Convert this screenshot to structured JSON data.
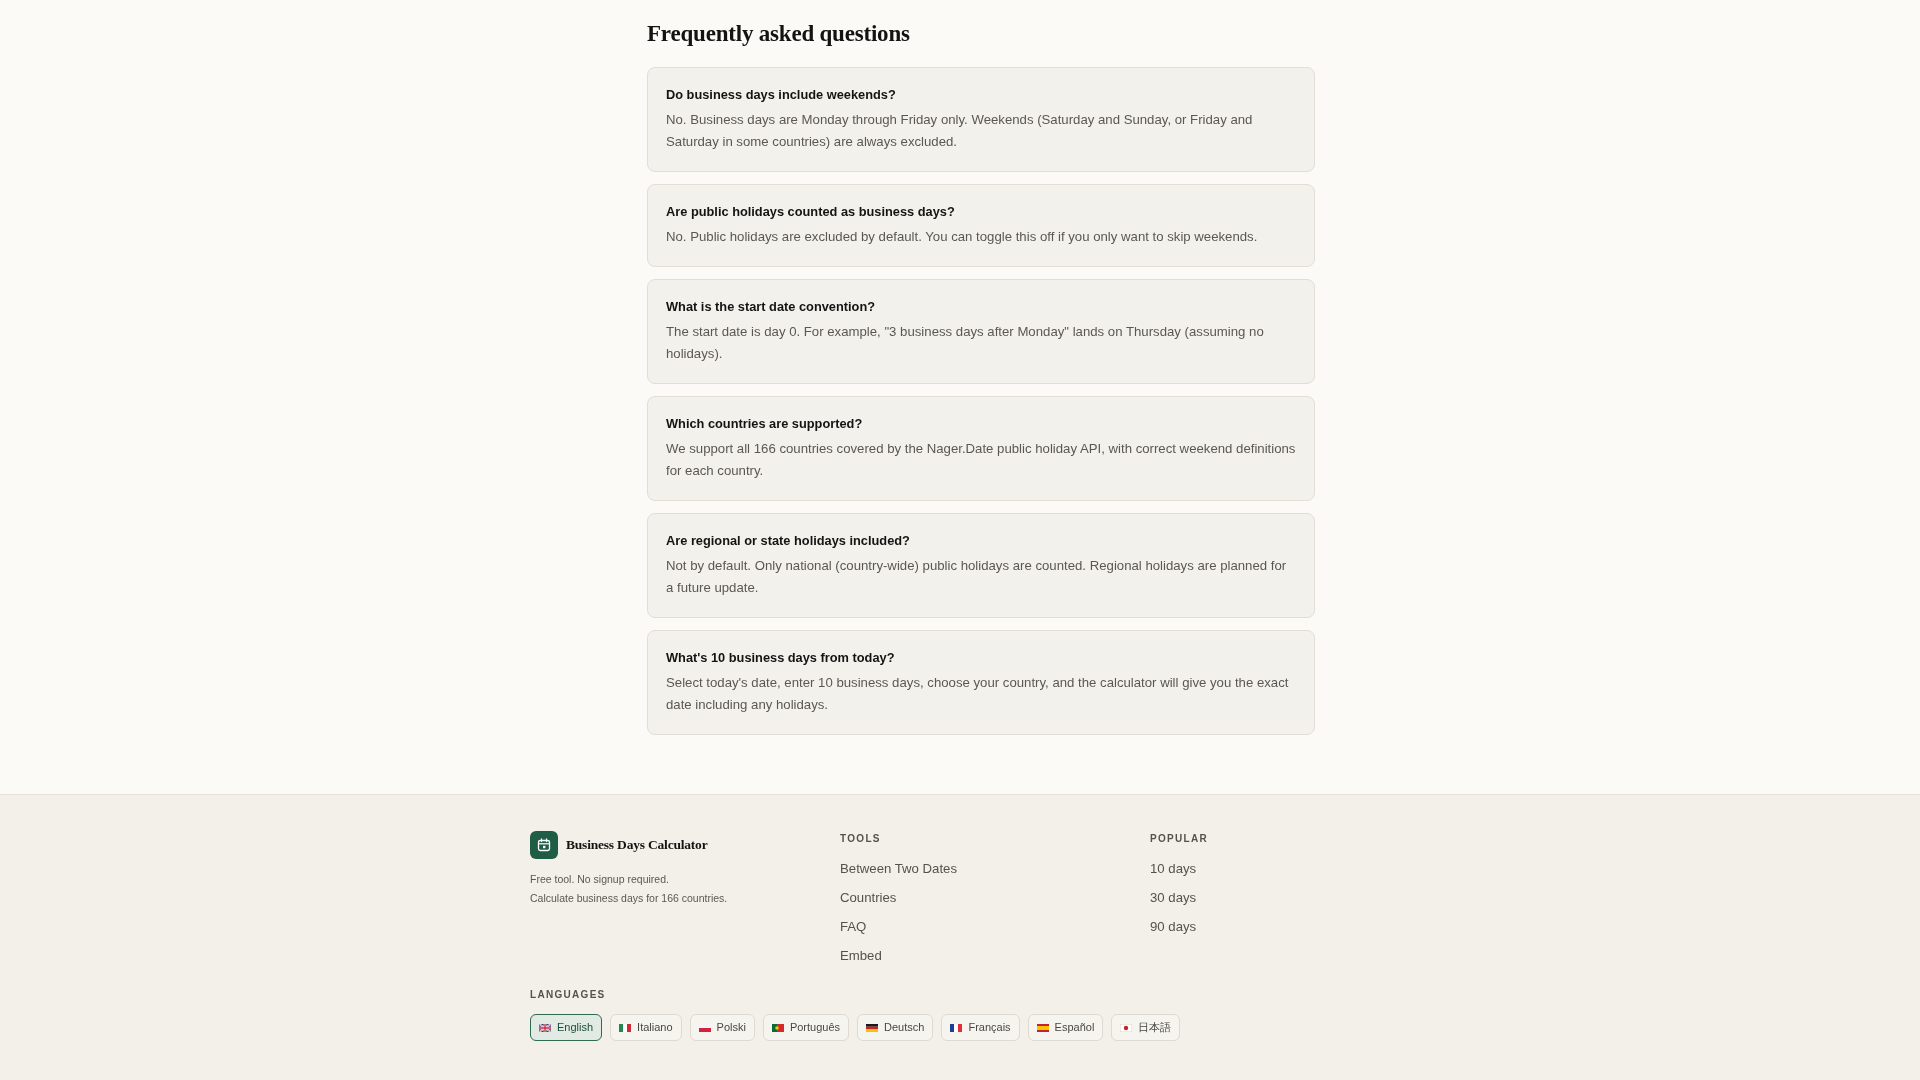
{
  "faq": {
    "title": "Frequently asked questions",
    "items": [
      {
        "question": "Do business days include weekends?",
        "answer": "No. Business days are Monday through Friday only. Weekends (Saturday and Sunday, or Friday and Saturday in some countries) are always excluded."
      },
      {
        "question": "Are public holidays counted as business days?",
        "answer": "No. Public holidays are excluded by default. You can toggle this off if you only want to skip weekends."
      },
      {
        "question": "What is the start date convention?",
        "answer": "The start date is day 0. For example, \"3 business days after Monday\" lands on Thursday (assuming no holidays)."
      },
      {
        "question": "Which countries are supported?",
        "answer": "We support all 166 countries covered by the Nager.Date public holiday API, with correct weekend definitions for each country."
      },
      {
        "question": "Are regional or state holidays included?",
        "answer": "Not by default. Only national (country-wide) public holidays are counted. Regional holidays are planned for a future update."
      },
      {
        "question": "What's 10 business days from today?",
        "answer": "Select today's date, enter 10 business days, choose your country, and the calculator will give you the exact date including any holidays."
      }
    ]
  },
  "footer": {
    "brand": {
      "name": "Business Days Calculator",
      "tagline": [
        "Free tool. No signup required.",
        "Calculate business days for 166 countries."
      ]
    },
    "columns": [
      {
        "heading": "TOOLS",
        "links": [
          "Between Two Dates",
          "Countries",
          "FAQ",
          "Embed"
        ]
      },
      {
        "heading": "POPULAR",
        "links": [
          "10 days",
          "30 days",
          "90 days"
        ]
      }
    ],
    "languages": {
      "heading": "LANGUAGES",
      "items": [
        {
          "label": "English",
          "kind": "uk",
          "selected": true
        },
        {
          "label": "Italiano",
          "kind": "it",
          "selected": false
        },
        {
          "label": "Polski",
          "kind": "pl",
          "selected": false
        },
        {
          "label": "Português",
          "kind": "pt",
          "selected": false
        },
        {
          "label": "Deutsch",
          "kind": "de",
          "selected": false
        },
        {
          "label": "Français",
          "kind": "fr",
          "selected": false
        },
        {
          "label": "Español",
          "kind": "es",
          "selected": false
        },
        {
          "label": "日本語",
          "kind": "jp",
          "selected": false
        }
      ]
    }
  }
}
